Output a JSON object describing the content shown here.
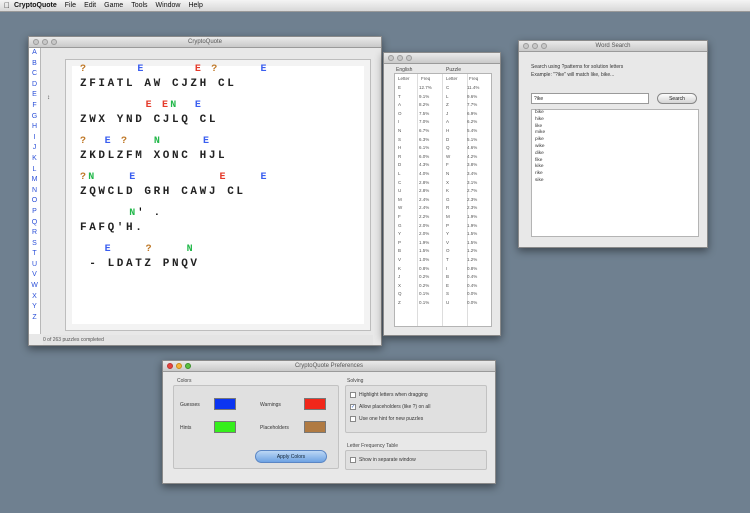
{
  "menubar": {
    "apple_icon": "apple-icon",
    "app_name": "CryptoQuote",
    "items": [
      "File",
      "Edit",
      "Game",
      "Tools",
      "Window",
      "Help"
    ]
  },
  "main_window": {
    "title": "CryptoQuote",
    "alphabet": [
      "A",
      "B",
      "C",
      "D",
      "E",
      "F",
      "G",
      "H",
      "I",
      "J",
      "K",
      "L",
      "M",
      "N",
      "O",
      "P",
      "Q",
      "R",
      "S",
      "T",
      "U",
      "V",
      "W",
      "X",
      "Y",
      "Z"
    ],
    "scroll_arrow": "↕",
    "status": "0 of 263 puzzles completed",
    "puzzle_rows": [
      {
        "hint": [
          [
            "?",
            "#c07a2a"
          ],
          [
            "      ",
            ""
          ],
          [
            "E",
            "#3a5ef0"
          ],
          [
            "      ",
            ""
          ],
          [
            "E",
            "#e53a2a"
          ],
          [
            " ",
            ""
          ],
          [
            "?",
            "#c07a2a"
          ],
          [
            "     ",
            ""
          ],
          [
            "E",
            "#3a5ef0"
          ]
        ],
        "cipher": "ZFIATL AW CJZH CL"
      },
      {
        "hint": [
          [
            "        ",
            ""
          ],
          [
            "E",
            "#e53a2a"
          ],
          [
            " ",
            ""
          ],
          [
            "E",
            "#e53a2a"
          ],
          [
            "N",
            "#22b84a"
          ],
          [
            "  ",
            ""
          ],
          [
            "E",
            "#3a5ef0"
          ]
        ],
        "cipher": "ZWX YND CJLQ CL"
      },
      {
        "hint": [
          [
            "?",
            "#c07a2a"
          ],
          [
            "  ",
            ""
          ],
          [
            "E",
            "#3a5ef0"
          ],
          [
            " ",
            ""
          ],
          [
            "?",
            "#c07a2a"
          ],
          [
            "   ",
            ""
          ],
          [
            "N",
            "#22b84a"
          ],
          [
            "     ",
            ""
          ],
          [
            "E",
            "#3a5ef0"
          ]
        ],
        "cipher": "ZKDLZFM XONC HJL"
      },
      {
        "hint": [
          [
            "?",
            "#c07a2a"
          ],
          [
            "N",
            "#22b84a"
          ],
          [
            "    ",
            ""
          ],
          [
            "E",
            "#3a5ef0"
          ],
          [
            "          ",
            ""
          ],
          [
            "E",
            "#e53a2a"
          ],
          [
            "    ",
            ""
          ],
          [
            "E",
            "#3a5ef0"
          ]
        ],
        "cipher": "ZQWCLD GRH CAWJ CL"
      },
      {
        "hint": [
          [
            "      ",
            ""
          ],
          [
            "N",
            "#22b84a"
          ],
          [
            "' .",
            ""
          ]
        ],
        "cipher": "FAFQ'H."
      },
      {
        "hint": [
          [
            "   ",
            ""
          ],
          [
            "E",
            "#3a5ef0"
          ],
          [
            "    ",
            ""
          ],
          [
            "?",
            "#c07a2a"
          ],
          [
            "    ",
            ""
          ],
          [
            "N",
            "#22b84a"
          ]
        ],
        "cipher": " - LDATZ PNQV"
      }
    ]
  },
  "freq_window": {
    "header_english": "English",
    "header_puzzle": "Puzzle",
    "col_letter": "Letter",
    "col_freq": "Freq",
    "rows": [
      [
        "E",
        "12.7%",
        "C",
        "11.4%"
      ],
      [
        "T",
        "9.1%",
        "L",
        "9.6%"
      ],
      [
        "A",
        "8.2%",
        "Z",
        "7.7%"
      ],
      [
        "O",
        "7.5%",
        "J",
        "6.9%"
      ],
      [
        "I",
        "7.0%",
        "A",
        "6.2%"
      ],
      [
        "N",
        "6.7%",
        "H",
        "5.4%"
      ],
      [
        "S",
        "6.3%",
        "D",
        "5.1%"
      ],
      [
        "H",
        "6.1%",
        "Q",
        "4.6%"
      ],
      [
        "R",
        "6.0%",
        "W",
        "4.2%"
      ],
      [
        "D",
        "4.3%",
        "F",
        "3.8%"
      ],
      [
        "L",
        "4.0%",
        "N",
        "3.4%"
      ],
      [
        "C",
        "2.8%",
        "X",
        "3.1%"
      ],
      [
        "U",
        "2.8%",
        "K",
        "2.7%"
      ],
      [
        "M",
        "2.4%",
        "G",
        "2.3%"
      ],
      [
        "W",
        "2.4%",
        "R",
        "2.3%"
      ],
      [
        "F",
        "2.2%",
        "M",
        "1.9%"
      ],
      [
        "G",
        "2.0%",
        "P",
        "1.9%"
      ],
      [
        "Y",
        "2.0%",
        "Y",
        "1.5%"
      ],
      [
        "P",
        "1.9%",
        "V",
        "1.5%"
      ],
      [
        "B",
        "1.5%",
        "O",
        "1.2%"
      ],
      [
        "V",
        "1.0%",
        "T",
        "1.2%"
      ],
      [
        "K",
        "0.8%",
        "I",
        "0.8%"
      ],
      [
        "J",
        "0.2%",
        "B",
        "0.4%"
      ],
      [
        "X",
        "0.2%",
        "E",
        "0.4%"
      ],
      [
        "Q",
        "0.1%",
        "S",
        "0.0%"
      ],
      [
        "Z",
        "0.1%",
        "U",
        "0.0%"
      ]
    ]
  },
  "word_search": {
    "title": "Word Search",
    "description": "Search using ?patterns for solution letters",
    "example": "Example: \"?ike\" will match like, bike...",
    "input_value": "?ike",
    "button": "Search",
    "results": [
      "bike",
      "hike",
      "like",
      "mike",
      "pike",
      "wike",
      "dike",
      "fike",
      "kike",
      "rike",
      "sike"
    ]
  },
  "prefs_window": {
    "title": "CryptoQuote Preferences",
    "colors_label": "Colors",
    "guess_label": "Guesses",
    "hints_label": "Hints",
    "warnings_label": "Warnings",
    "placeholders_label": "Placeholders",
    "apply_button": "Apply Colors",
    "solving_label": "Solving",
    "opt1": "Highlight letters when dragging",
    "opt2": "Allow placeholders (like ?) on all",
    "opt3": "Use one hint for new puzzles",
    "freq_label": "Letter Frequency Table",
    "opt4": "Show in separate window",
    "colors": {
      "guess": "#0b35f2",
      "hints": "#35ef1c",
      "warnings": "#f2271a",
      "placeholders": "#b07a42"
    }
  }
}
